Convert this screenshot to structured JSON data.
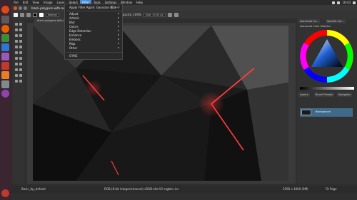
{
  "menubar": {
    "app_name": "Krita",
    "items": [
      "File",
      "Edit",
      "View",
      "Image",
      "Layer",
      "Select",
      "Filter",
      "Tools",
      "Settings",
      "Window",
      "Help"
    ],
    "active_index": 6
  },
  "tray": {
    "clock": "16:43"
  },
  "window": {
    "title": "black-polygons-with-red-edge... (modified) – Krita"
  },
  "toolbar": {
    "blend_mode": "Normal",
    "opacity_label": "Opacity: 100%",
    "size_label": "Size: 30.00 px"
  },
  "tabs": [
    {
      "label": "black-polygons-with-red-edge...-3200.jpg"
    }
  ],
  "filter_menu": {
    "apply_again": "Apply Filter Again: Gaussian Blur",
    "apply_again_shortcut": "Ctrl+F",
    "items": [
      "Adjust",
      "Artistic",
      "Blur",
      "Colors",
      "Edge Detection",
      "Enhance",
      "Emboss",
      "Map",
      "Other"
    ],
    "gmic": "G'MIC"
  },
  "dock": {
    "top_tabs": [
      "Advanced Co...",
      "Specific Col..."
    ],
    "color_selector_title": "Advanced Color Selector",
    "bottom_tabs": [
      "Layers",
      "Brush Presets",
      "Navigator"
    ],
    "layer_name": "Background"
  },
  "statusbar": {
    "brush": "Basic_tip_default",
    "color_info": "RGB (8-bit integer/channel) sRGB-elle-V2-srgbtrc.icc",
    "dimensions": "2560 x 1600 (9M)",
    "page": "Fit Page"
  },
  "colors": {
    "accent": "#4a90d9",
    "launcher": "#3b2530",
    "canvas_red": "#ff3b3b"
  }
}
